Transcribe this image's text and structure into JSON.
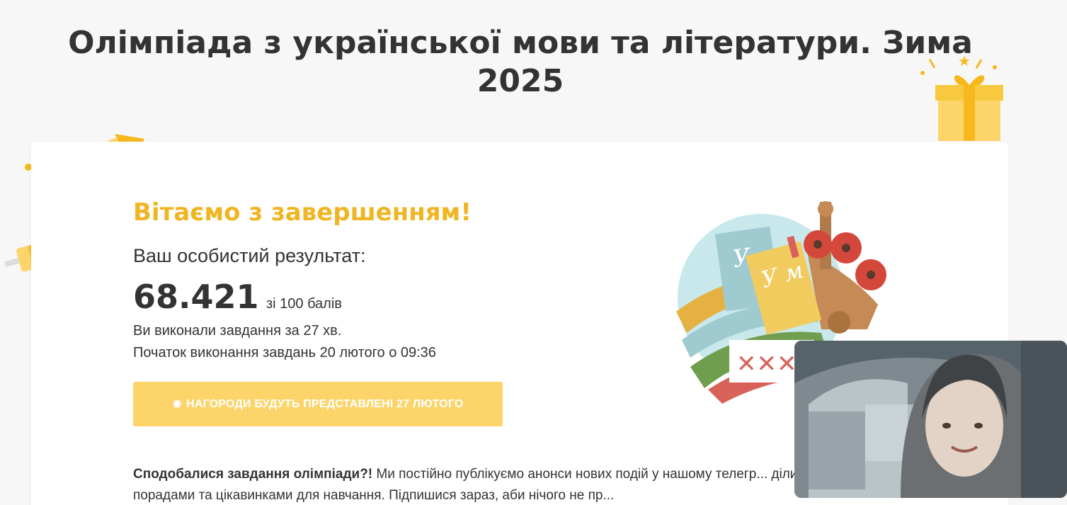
{
  "page": {
    "title": "Олімпіада з української мови та літератури. Зима 2025"
  },
  "result": {
    "congrats": "Вітаємо з завершенням!",
    "label": "Ваш особистий результат:",
    "score": "68.421",
    "score_suffix": "зі 100 балів",
    "time_info": "Ви виконали завдання за 27 хв.",
    "start_info": "Початок виконання завдань 20 лютого о 09:36"
  },
  "awards_button": {
    "icon": "gear-icon",
    "label": "НАГОРОДИ БУДУТЬ ПРЕДСТАВЛЕНІ 27 ЛЮТОГО"
  },
  "promo": {
    "bold": "Сподобалися завдання олімпіади?!",
    "text": " Ми постійно публікуємо анонси нових подій у нашому телегр... ділимося корисними порадами та цікавинками для навчання. Підпишися зараз, аби нічого не пр..."
  },
  "illustration": {
    "book1_letters": "У л",
    "book2_letters": "У м"
  },
  "colors": {
    "accent": "#f0b522",
    "button": "#fcd46a",
    "background": "#f7f7f7"
  }
}
